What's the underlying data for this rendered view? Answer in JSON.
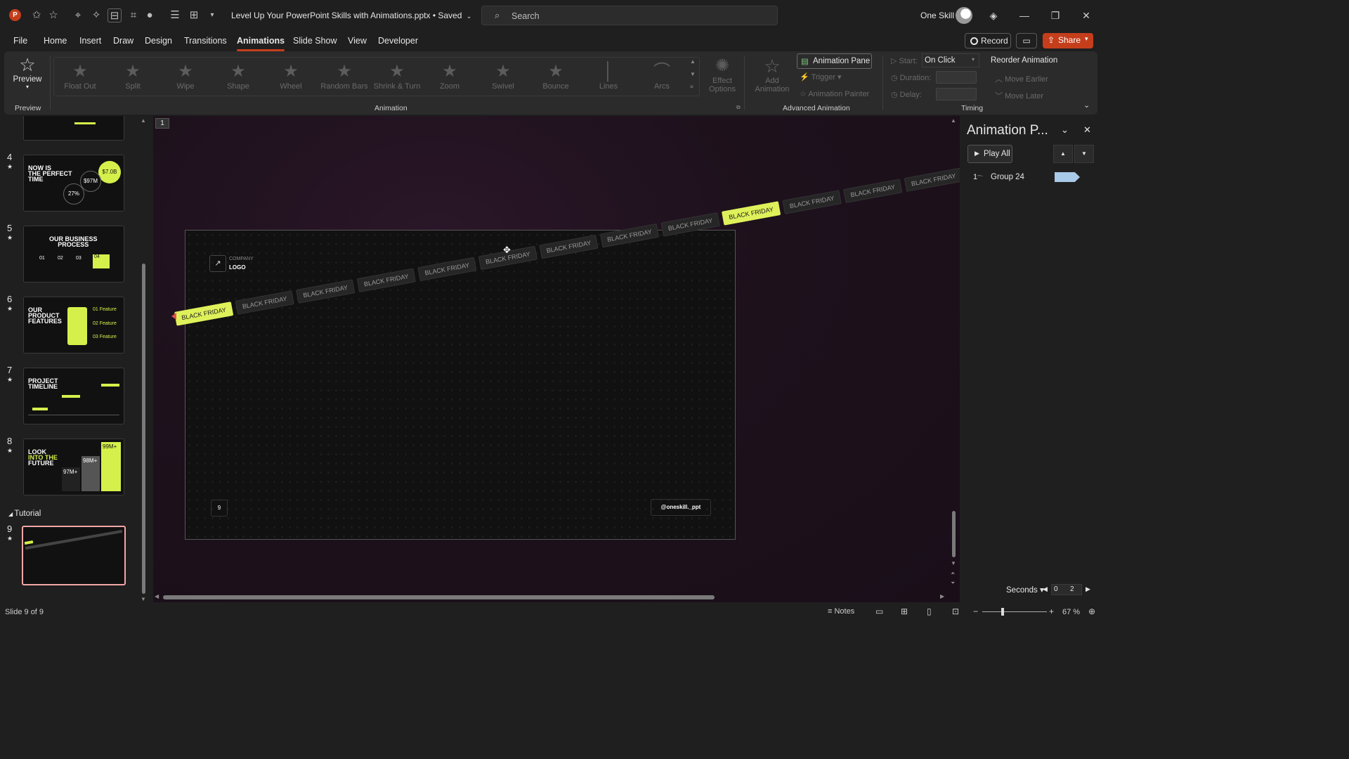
{
  "app": {
    "title": "Level Up Your PowerPoint Skills with Animations.pptx • Saved"
  },
  "search": {
    "placeholder": "Search"
  },
  "user": {
    "name": "One Skill"
  },
  "menu": [
    "File",
    "Home",
    "Insert",
    "Draw",
    "Design",
    "Transitions",
    "Animations",
    "Slide Show",
    "View",
    "Developer"
  ],
  "menu_active": "Animations",
  "actions": {
    "record": "Record",
    "share": "Share"
  },
  "ribbon": {
    "preview": {
      "label": "Preview",
      "group": "Preview"
    },
    "animation_group": "Animation",
    "effects": [
      "Float Out",
      "Split",
      "Wipe",
      "Shape",
      "Wheel",
      "Random Bars",
      "Shrink & Turn",
      "Zoom",
      "Swivel",
      "Bounce",
      "Lines",
      "Arcs"
    ],
    "effect_options": [
      "Effect",
      "Options"
    ],
    "add_animation": [
      "Add",
      "Animation"
    ],
    "animation_pane": "Animation Pane",
    "trigger": "Trigger",
    "animation_painter": "Animation Painter",
    "advanced_group": "Advanced Animation",
    "start_label": "Start:",
    "start_value": "On Click",
    "duration_label": "Duration:",
    "delay_label": "Delay:",
    "reorder": "Reorder Animation",
    "move_earlier": "Move Earlier",
    "move_later": "Move Later",
    "timing_group": "Timing"
  },
  "thumbnails": {
    "section": "Tutorial",
    "slides": [
      {
        "num": "4",
        "title": [
          "NOW IS",
          "THE PERFECT",
          "TIME"
        ],
        "stats": [
          "$7.0B",
          "$97M",
          "27%"
        ]
      },
      {
        "num": "5",
        "title": [
          "OUR BUSINESS",
          "PROCESS"
        ],
        "stats": [
          "01",
          "02",
          "03",
          "04"
        ]
      },
      {
        "num": "6",
        "title": [
          "OUR",
          "PRODUCT",
          "FEATURES"
        ],
        "stats": [
          "01 Feature",
          "02 Feature",
          "03 Feature"
        ]
      },
      {
        "num": "7",
        "title": [
          "PROJECT",
          "TIMELINE"
        ],
        "stats": []
      },
      {
        "num": "8",
        "title": [
          "LOOK",
          "INTO THE",
          "FUTURE"
        ],
        "stats": [
          "99M+",
          "98M+",
          "97M+"
        ]
      },
      {
        "num": "9",
        "title": [],
        "stats": []
      }
    ]
  },
  "slide": {
    "badge": "1",
    "company_label": "COMPANY",
    "logo_label": "LOGO",
    "page_num": "9",
    "handle": "@oneskill._ppt",
    "tape_text": "BLACK FRIDAY"
  },
  "pane": {
    "title": "Animation P...",
    "play_all": "Play All",
    "items": [
      {
        "index": "1",
        "name": "Group 24",
        "bar_color": "#a9c9e8"
      }
    ],
    "seconds": "Seconds",
    "timeline": [
      "0",
      "2"
    ]
  },
  "status": {
    "slide_info": "Slide 9 of 9",
    "notes": "Notes",
    "zoom": "67 %",
    "zoom_level": 0.67
  },
  "colors": {
    "accent": "#c43e1c",
    "lime": "#dff15a"
  }
}
